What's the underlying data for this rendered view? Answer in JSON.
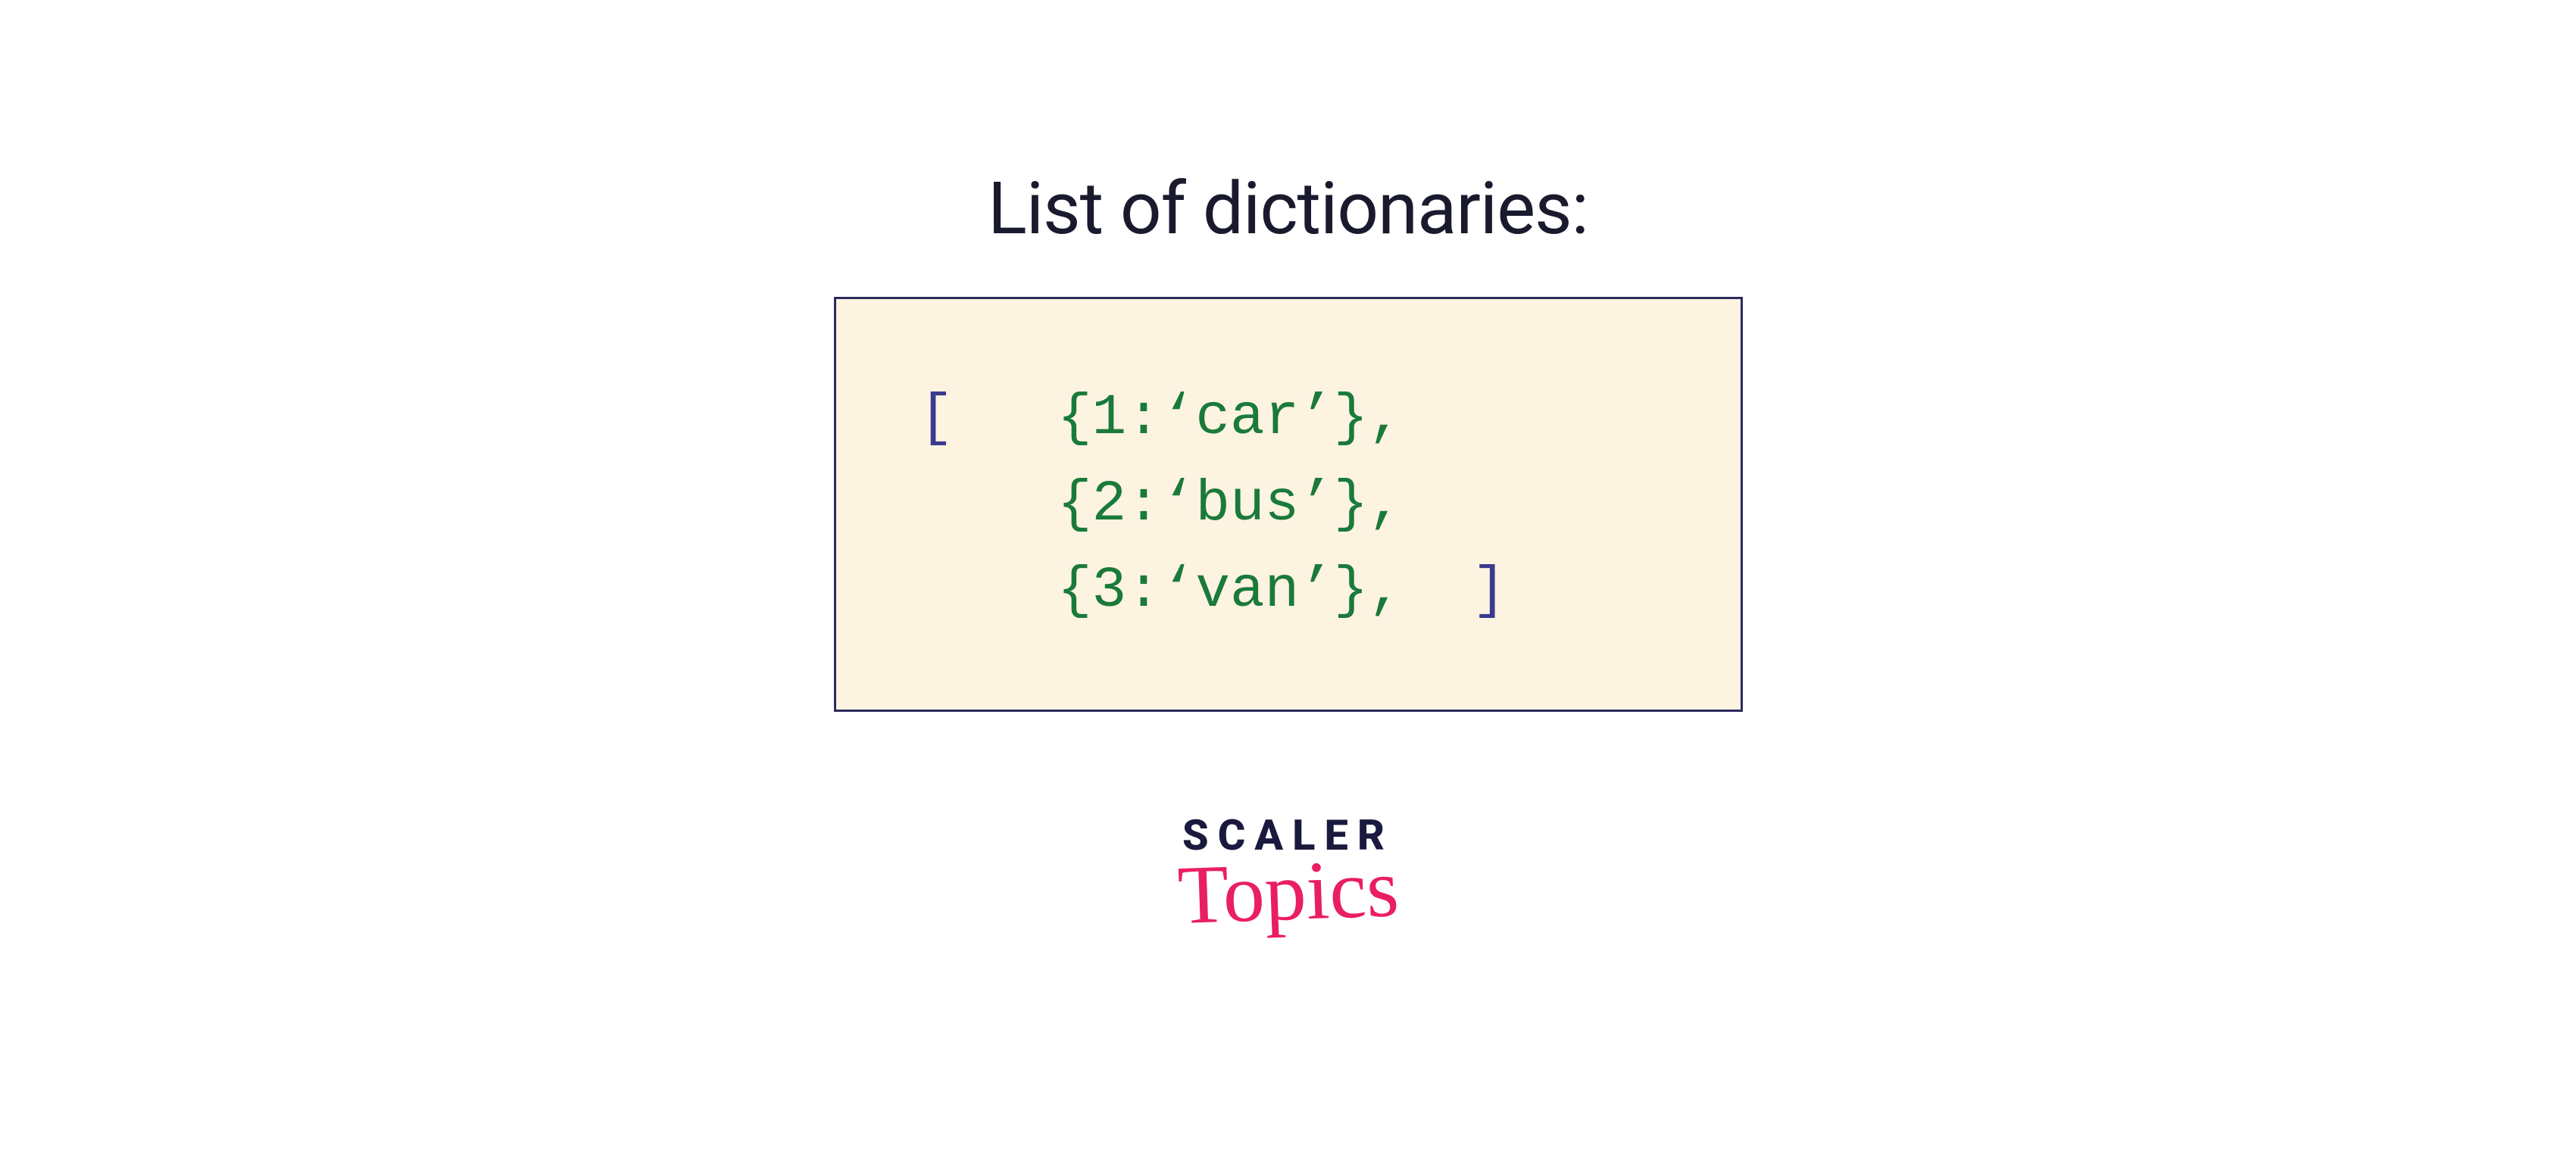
{
  "title": "List of dictionaries:",
  "code": {
    "open_bracket": "[",
    "close_bracket": "]",
    "lines": [
      {
        "dict": "{1:‘car’}",
        "comma": ","
      },
      {
        "dict": "{2:‘bus’}",
        "comma": ","
      },
      {
        "dict": "{3:‘van’}",
        "comma": ","
      }
    ]
  },
  "logo": {
    "main": "SCALER",
    "sub": "Topics"
  },
  "colors": {
    "bracket": "#3a3a8e",
    "dict_text": "#1a7a3a",
    "box_bg": "#fdf3e1",
    "box_border": "#2a2a5e",
    "title_color": "#1a1a2e",
    "logo_main": "#1a1a3e",
    "logo_sub": "#e91e63"
  }
}
